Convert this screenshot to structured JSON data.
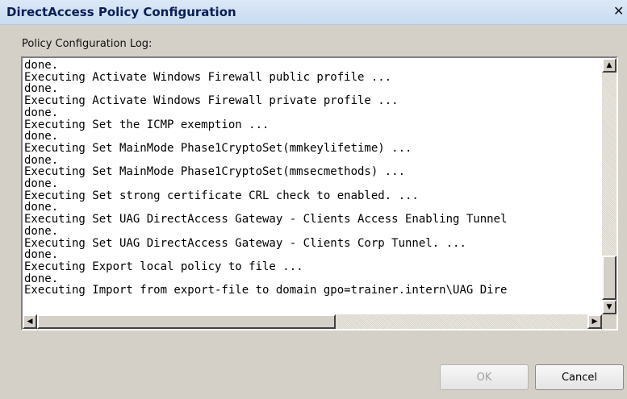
{
  "window": {
    "title": "DirectAccess Policy Configuration",
    "close_glyph": "✕"
  },
  "log": {
    "label": "Policy Configuration Log:",
    "lines": [
      "done.",
      "Executing Activate Windows Firewall public profile ...",
      "done.",
      "Executing Activate Windows Firewall private profile ...",
      "done.",
      "Executing Set the ICMP exemption ...",
      "done.",
      "Executing Set MainMode Phase1CryptoSet(mmkeylifetime) ...",
      "done.",
      "Executing Set MainMode Phase1CryptoSet(mmsecmethods) ...",
      "done.",
      "Executing Set strong certificate CRL check to enabled. ...",
      "done.",
      "Executing Set UAG DirectAccess Gateway - Clients Access Enabling Tunnel",
      "done.",
      "Executing Set UAG DirectAccess Gateway - Clients Corp Tunnel. ...",
      "done.",
      "Executing Export local policy to file ...",
      "done.",
      "Executing Import from export-file to domain gpo=trainer.intern\\UAG Dire"
    ]
  },
  "scrollbars": {
    "up_glyph": "▲",
    "down_glyph": "▼",
    "left_glyph": "◀",
    "right_glyph": "▶"
  },
  "buttons": {
    "ok": "OK",
    "cancel": "Cancel"
  }
}
